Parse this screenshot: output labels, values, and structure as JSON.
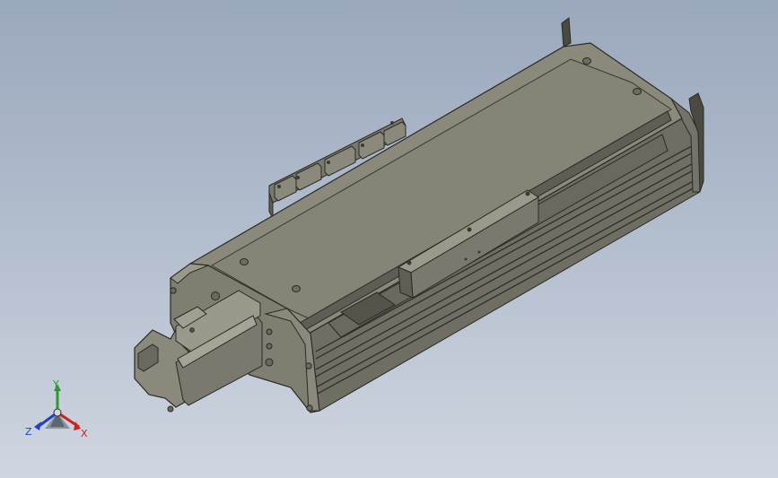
{
  "viewport": {
    "background_top": "#9aa8bd",
    "background_bottom": "#cfd6e1"
  },
  "model": {
    "name": "linear-actuator-module",
    "body_color": "#807f72",
    "top_color": "#8a897c",
    "shadow_color": "#5f5e54",
    "edge_color": "#2a2a25"
  },
  "triad": {
    "x_label": "X",
    "y_label": "Y",
    "z_label": "Z",
    "x_color": "#d21e1e",
    "y_color": "#2a9a2a",
    "z_color": "#1f3fd0"
  }
}
